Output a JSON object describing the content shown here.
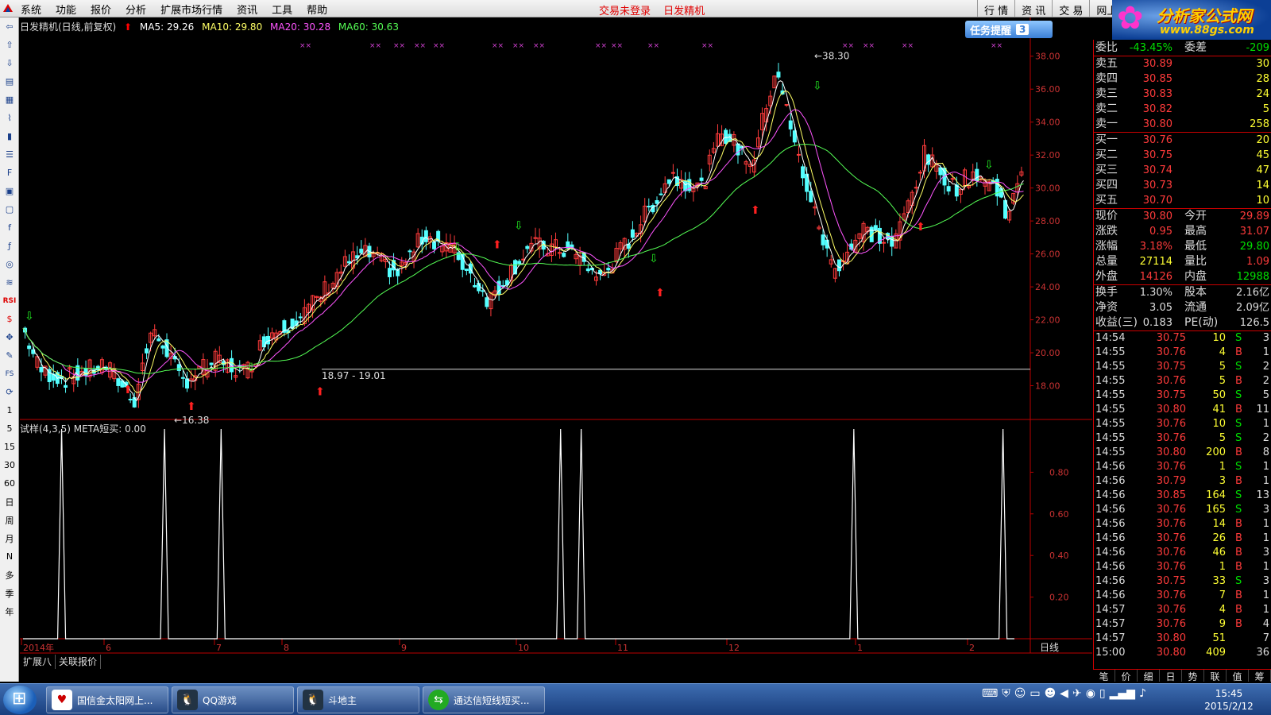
{
  "menubar": {
    "items": [
      "系统",
      "功能",
      "报价",
      "分析",
      "扩展市场行情",
      "资讯",
      "工具",
      "帮助"
    ],
    "center_msgs": [
      "交易未登录",
      "日发精机"
    ],
    "right_tabs": [
      "行 情",
      "资 讯",
      "交 易",
      "网上"
    ],
    "brand_title": "分析家公式网",
    "brand_url": "www.88gs.com"
  },
  "left_toolbar": {
    "period_labels": [
      "1",
      "5",
      "15",
      "30",
      "60",
      "日",
      "周",
      "月",
      "N",
      "多",
      "季",
      "年"
    ]
  },
  "chart_header": {
    "title": "日发精机(日线,前复权)",
    "ma5": "MA5: 29.26",
    "ma10": "MA10: 29.80",
    "ma20": "MA20: 30.28",
    "ma60": "MA60: 30.63",
    "colors": {
      "ma5": "#ffffff",
      "ma10": "#ffff66",
      "ma20": "#ff55ff",
      "ma60": "#55ff55"
    }
  },
  "task_reminder": {
    "label": "任务提醒",
    "count": "3"
  },
  "sub_legend": "试样(4,3,5)  META短买: 0.00",
  "price_annotations": {
    "high": "38.30",
    "low": "16.38",
    "line": "18.97 - 19.01"
  },
  "chart_data": [
    {
      "type": "candlestick",
      "y_axis_labels": [
        "38.00",
        "36.00",
        "34.00",
        "32.00",
        "30.00",
        "28.00",
        "26.00",
        "24.00",
        "22.00",
        "20.00",
        "18.00"
      ],
      "ylim": [
        16.0,
        39.0
      ],
      "x_axis_labels": [
        "2014年",
        "6",
        "7",
        "8",
        "9",
        "10",
        "11",
        "12",
        "1",
        "2"
      ],
      "period_label": "日线",
      "series": [
        {
          "name": "MA5",
          "color": "#ffffff"
        },
        {
          "name": "MA10",
          "color": "#ffff66"
        },
        {
          "name": "MA20",
          "color": "#ff55ff"
        },
        {
          "name": "MA60",
          "color": "#55ff55"
        }
      ]
    },
    {
      "type": "line",
      "name": "META短买",
      "y_axis_labels": [
        "0.80",
        "0.60",
        "0.40",
        "0.20"
      ],
      "ylim": [
        0,
        1.0
      ],
      "spikes_at_bar": [
        15,
        55,
        77,
        209,
        217,
        323,
        381
      ]
    }
  ],
  "bottom_tabs": [
    "扩展八",
    "关联报价"
  ],
  "quote": {
    "weibi_label": "委比",
    "weibi": "-43.45%",
    "weicha_label": "委差",
    "weicha": "-209",
    "sells": [
      {
        "label": "卖五",
        "price": "30.89",
        "vol": "30"
      },
      {
        "label": "卖四",
        "price": "30.85",
        "vol": "28"
      },
      {
        "label": "卖三",
        "price": "30.83",
        "vol": "24"
      },
      {
        "label": "卖二",
        "price": "30.82",
        "vol": "5"
      },
      {
        "label": "卖一",
        "price": "30.80",
        "vol": "258"
      }
    ],
    "buys": [
      {
        "label": "买一",
        "price": "30.76",
        "vol": "20"
      },
      {
        "label": "买二",
        "price": "30.75",
        "vol": "45"
      },
      {
        "label": "买三",
        "price": "30.74",
        "vol": "47"
      },
      {
        "label": "买四",
        "price": "30.73",
        "vol": "14"
      },
      {
        "label": "买五",
        "price": "30.70",
        "vol": "10"
      }
    ],
    "stats": [
      {
        "l1": "现价",
        "v1": "30.80",
        "c1": "red",
        "l2": "今开",
        "v2": "29.89",
        "c2": "red"
      },
      {
        "l1": "涨跌",
        "v1": "0.95",
        "c1": "red",
        "l2": "最高",
        "v2": "31.07",
        "c2": "red"
      },
      {
        "l1": "涨幅",
        "v1": "3.18%",
        "c1": "red",
        "l2": "最低",
        "v2": "29.80",
        "c2": "grn"
      },
      {
        "l1": "总量",
        "v1": "27114",
        "c1": "yel",
        "l2": "量比",
        "v2": "1.09",
        "c2": "red"
      },
      {
        "l1": "外盘",
        "v1": "14126",
        "c1": "red",
        "l2": "内盘",
        "v2": "12988",
        "c2": "grn"
      }
    ],
    "stats2": [
      {
        "l1": "换手",
        "v1": "1.30%",
        "l2": "股本",
        "v2": "2.16亿"
      },
      {
        "l1": "净资",
        "v1": "3.05",
        "l2": "流通",
        "v2": "2.09亿"
      },
      {
        "l1": "收益(三)",
        "v1": "0.183",
        "l2": "PE(动)",
        "v2": "126.5"
      }
    ],
    "ticks": [
      {
        "t": "14:54",
        "p": "30.75",
        "v": "10",
        "bs": "S",
        "n": "3"
      },
      {
        "t": "14:55",
        "p": "30.76",
        "v": "4",
        "bs": "B",
        "n": "1"
      },
      {
        "t": "14:55",
        "p": "30.75",
        "v": "5",
        "bs": "S",
        "n": "2"
      },
      {
        "t": "14:55",
        "p": "30.76",
        "v": "5",
        "bs": "B",
        "n": "2"
      },
      {
        "t": "14:55",
        "p": "30.75",
        "v": "50",
        "bs": "S",
        "n": "5"
      },
      {
        "t": "14:55",
        "p": "30.80",
        "v": "41",
        "bs": "B",
        "n": "11"
      },
      {
        "t": "14:55",
        "p": "30.76",
        "v": "10",
        "bs": "S",
        "n": "1"
      },
      {
        "t": "14:55",
        "p": "30.76",
        "v": "5",
        "bs": "S",
        "n": "2"
      },
      {
        "t": "14:55",
        "p": "30.80",
        "v": "200",
        "bs": "B",
        "n": "8"
      },
      {
        "t": "14:56",
        "p": "30.76",
        "v": "1",
        "bs": "S",
        "n": "1"
      },
      {
        "t": "14:56",
        "p": "30.79",
        "v": "3",
        "bs": "B",
        "n": "1"
      },
      {
        "t": "14:56",
        "p": "30.85",
        "v": "164",
        "bs": "S",
        "n": "13"
      },
      {
        "t": "14:56",
        "p": "30.76",
        "v": "165",
        "bs": "S",
        "n": "3"
      },
      {
        "t": "14:56",
        "p": "30.76",
        "v": "14",
        "bs": "B",
        "n": "1"
      },
      {
        "t": "14:56",
        "p": "30.76",
        "v": "26",
        "bs": "B",
        "n": "1"
      },
      {
        "t": "14:56",
        "p": "30.76",
        "v": "46",
        "bs": "B",
        "n": "3"
      },
      {
        "t": "14:56",
        "p": "30.76",
        "v": "1",
        "bs": "B",
        "n": "1"
      },
      {
        "t": "14:56",
        "p": "30.75",
        "v": "33",
        "bs": "S",
        "n": "3"
      },
      {
        "t": "14:56",
        "p": "30.76",
        "v": "7",
        "bs": "B",
        "n": "1"
      },
      {
        "t": "14:57",
        "p": "30.76",
        "v": "4",
        "bs": "B",
        "n": "1"
      },
      {
        "t": "14:57",
        "p": "30.76",
        "v": "9",
        "bs": "B",
        "n": "4"
      },
      {
        "t": "14:57",
        "p": "30.80",
        "v": "51",
        "bs": "",
        "n": "7"
      },
      {
        "t": "15:00",
        "p": "30.80",
        "v": "409",
        "bs": "",
        "n": "36"
      }
    ]
  },
  "quote_tabs": [
    "笔",
    "价",
    "细",
    "日",
    "势",
    "联",
    "值",
    "筹"
  ],
  "taskbar": {
    "buttons": [
      "国信金太阳网上...",
      "QQ游戏",
      "斗地主",
      "通达信短线短买..."
    ],
    "time": "15:45",
    "date": "2015/2/12"
  }
}
